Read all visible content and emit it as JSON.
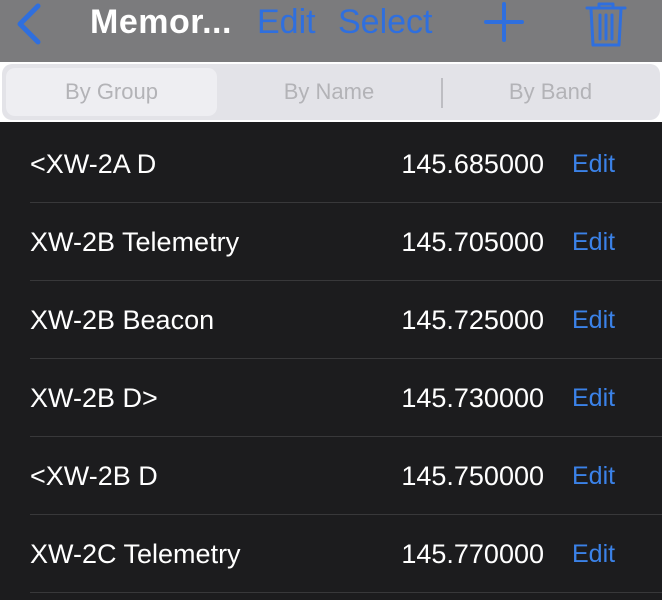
{
  "navbar": {
    "back_icon": "chevron-left-icon",
    "title": "Memor...",
    "edit_label": "Edit",
    "select_label": "Select",
    "add_icon": "plus-icon",
    "trash_icon": "trash-icon",
    "accent_color": "#2f6fde"
  },
  "segments": {
    "selected": "By Group",
    "items": [
      {
        "label": "By Group"
      },
      {
        "label": "By Name"
      },
      {
        "label": "By Band"
      }
    ]
  },
  "memories": [
    {
      "name": "<XW-2A D",
      "frequency": "145.685000",
      "edit_label": "Edit"
    },
    {
      "name": "XW-2B Telemetry",
      "frequency": "145.705000",
      "edit_label": "Edit"
    },
    {
      "name": "XW-2B Beacon",
      "frequency": "145.725000",
      "edit_label": "Edit"
    },
    {
      "name": "XW-2B D>",
      "frequency": "145.730000",
      "edit_label": "Edit"
    },
    {
      "name": "<XW-2B D",
      "frequency": "145.750000",
      "edit_label": "Edit"
    },
    {
      "name": "XW-2C Telemetry",
      "frequency": "145.770000",
      "edit_label": "Edit"
    }
  ]
}
